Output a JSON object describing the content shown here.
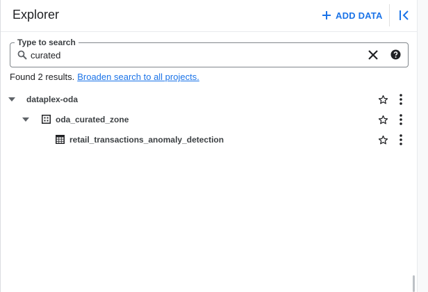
{
  "header": {
    "title": "Explorer",
    "add_data_label": "ADD DATA"
  },
  "search": {
    "legend": "Type to search",
    "value": "curated"
  },
  "results": {
    "text": "Found 2 results.",
    "link": "Broaden search to all projects."
  },
  "tree": [
    {
      "label": "dataplex-oda",
      "level": 0,
      "expanded": true,
      "icon": "none"
    },
    {
      "label": "oda_curated_zone",
      "level": 1,
      "expanded": true,
      "icon": "zone-icon"
    },
    {
      "label": "retail_transactions_anomaly_detection",
      "level": 2,
      "expanded": false,
      "icon": "table-icon"
    }
  ],
  "colors": {
    "accent": "#1a73e8",
    "text": "#202124",
    "border": "#80868b"
  }
}
